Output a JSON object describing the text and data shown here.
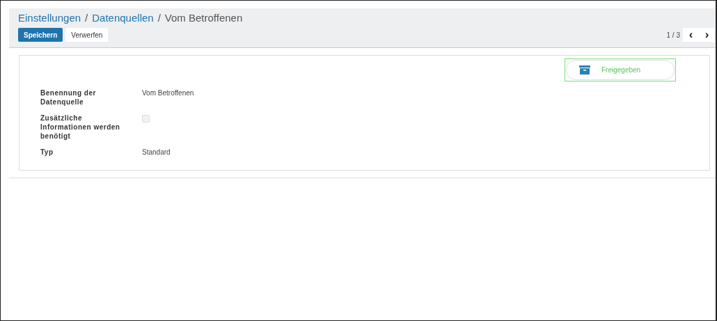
{
  "breadcrumbs": [
    {
      "label": "Einstellungen",
      "kind": "link"
    },
    {
      "label": "Datenquellen",
      "kind": "link"
    },
    {
      "label": "Vom Betroffenen",
      "kind": "current"
    }
  ],
  "breadcrumb_separator": "/",
  "buttons": [
    {
      "label": "Speichern",
      "kind": "primary"
    },
    {
      "label": "Verwerfen",
      "kind": "secondary"
    }
  ],
  "pager": {
    "counter": "1 / 3",
    "prev": "‹",
    "next": "›"
  },
  "status_button": {
    "label": "Freigegeben"
  },
  "fields": [
    {
      "label": "Benennung der Datenquelle",
      "kind": "text",
      "value": "Vom Betroffenen"
    },
    {
      "label": "Zusätzliche Informationen werden benötigt",
      "kind": "checkbox",
      "checked": false
    },
    {
      "label": "Typ",
      "kind": "text",
      "value": "Standard"
    }
  ]
}
